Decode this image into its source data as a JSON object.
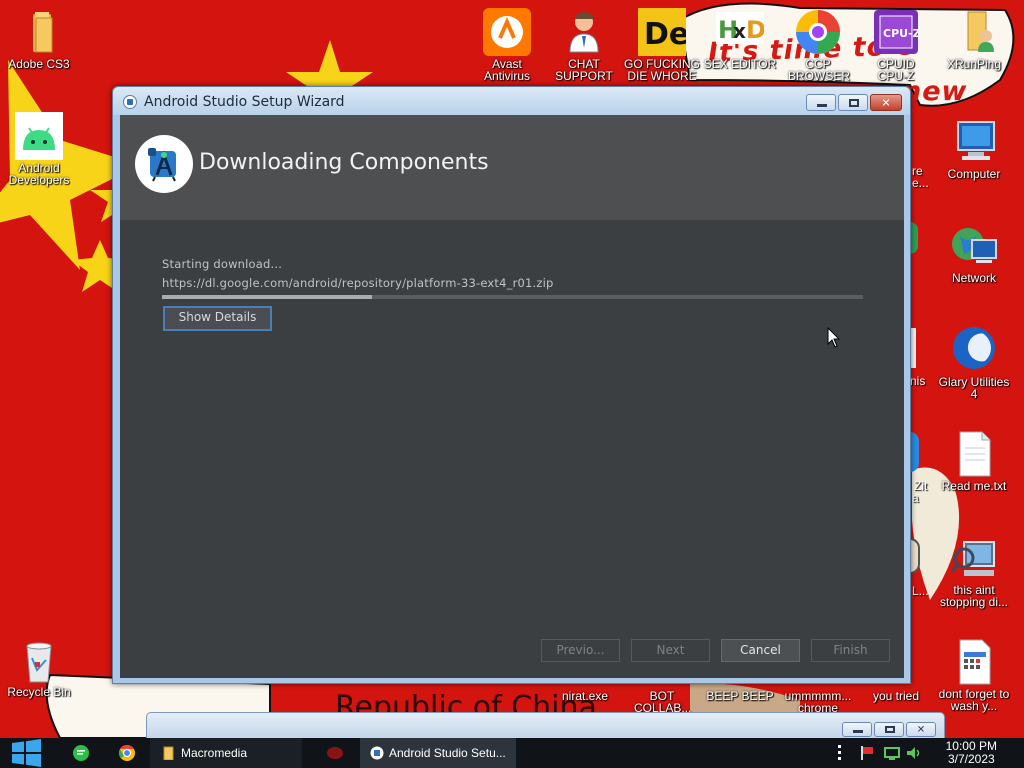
{
  "desktop": {
    "left_icons": [
      {
        "name": "adobe-cs3",
        "label": "Adobe CS3"
      },
      {
        "name": "android-developers",
        "label": "Android Developers"
      },
      {
        "name": "recycle-bin",
        "label": "Recycle Bin"
      }
    ],
    "top_icons": [
      {
        "name": "avast-antivirus",
        "label": "Avast Antivirus"
      },
      {
        "name": "chat-support",
        "label": "CHAT SUPPORT"
      },
      {
        "name": "die-game",
        "label": "GO FUCKING DIE WHORE"
      },
      {
        "name": "hxd-editor",
        "label": "SEX EDITOR"
      },
      {
        "name": "ccp-browser",
        "label": "CCP BROWSER"
      },
      {
        "name": "cpuid-cpuz",
        "label": "CPUID CPU-Z"
      },
      {
        "name": "xrunping",
        "label": "XRunPing"
      }
    ],
    "right_icons": [
      {
        "name": "computer",
        "label": "Computer"
      },
      {
        "name": "network",
        "label": "Network"
      },
      {
        "name": "glary-utilities",
        "label": "Glary Utilities 4"
      },
      {
        "name": "read-me",
        "label": "Read me.txt"
      },
      {
        "name": "this-aint-stopping",
        "label": "this aint stopping di..."
      },
      {
        "name": "dont-forget",
        "label": "dont forget to wash y..."
      }
    ],
    "partial_labels": [
      "re",
      "e...",
      "nis",
      "Zit",
      "a",
      "L..."
    ],
    "bottom_icons": [
      {
        "name": "nirat",
        "label": "nirat.exe"
      },
      {
        "name": "bot-collab",
        "label": "BOT COLLAB..."
      },
      {
        "name": "beep-beep",
        "label": "BEEP BEEP"
      },
      {
        "name": "ummmm-chrome",
        "label": "ummmmm... chrome"
      },
      {
        "name": "you-tried",
        "label": "you tried"
      }
    ],
    "wallpaper_text": {
      "top": "It's time to c",
      "top2": "new",
      "bottom": "Republic of China"
    }
  },
  "window": {
    "title": "Android Studio Setup Wizard",
    "heading": "Downloading Components",
    "status": "Starting download...",
    "url": "https://dl.google.com/android/repository/platform-33-ext4_r01.zip",
    "progress_percent": 30,
    "show_details": "Show Details",
    "buttons": {
      "previous": "Previo...",
      "next": "Next",
      "cancel": "Cancel",
      "finish": "Finish"
    }
  },
  "taskbar": {
    "items": [
      {
        "name": "macromedia",
        "label": "Macromedia"
      },
      {
        "name": "android-studio-setup",
        "label": "Android Studio Setu..."
      }
    ],
    "clock_time": "10:00 PM",
    "clock_date": "3/7/2023"
  },
  "colors": {
    "wallpaper_red": "#d4140f",
    "star_yellow": "#f7d417",
    "window_bg": "#3c3f41",
    "banner_bg": "#4d4f51",
    "focus_blue": "#4a7fb4"
  }
}
